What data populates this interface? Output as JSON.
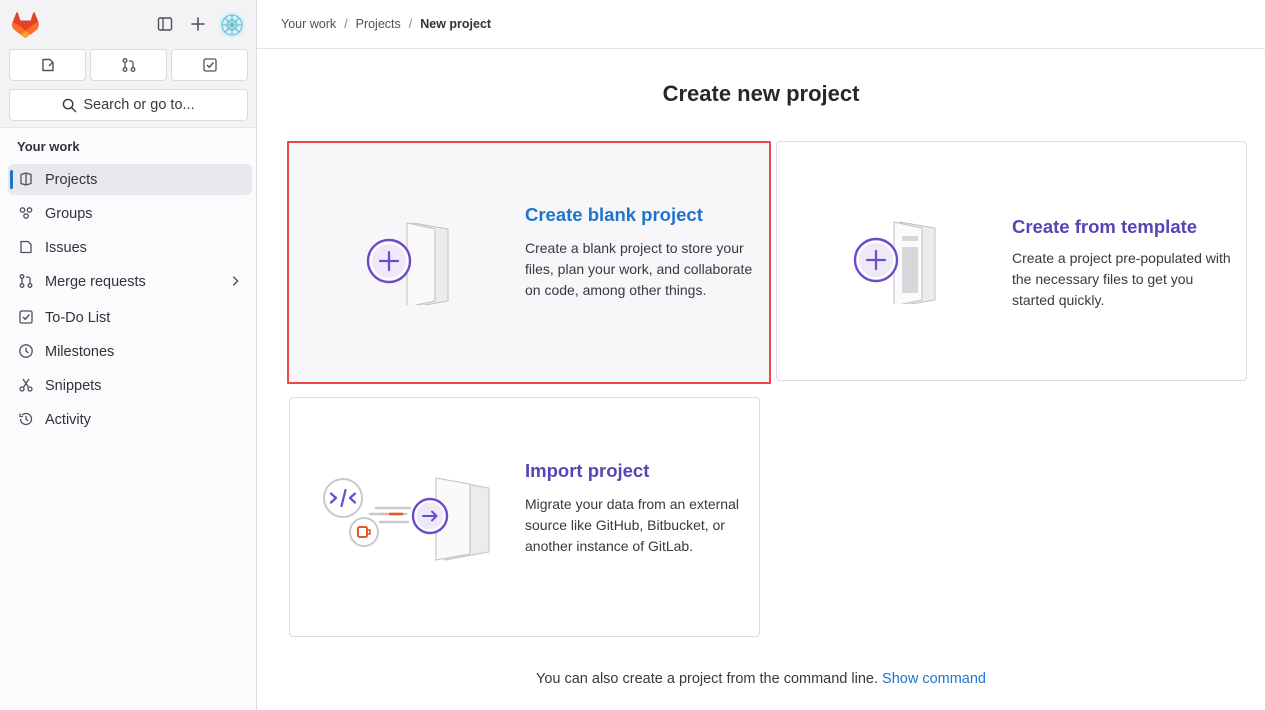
{
  "sidebar": {
    "search_label": "Search or go to...",
    "section_title": "Your work",
    "items": [
      {
        "label": "Projects",
        "icon": "project-icon"
      },
      {
        "label": "Groups",
        "icon": "group-icon"
      },
      {
        "label": "Issues",
        "icon": "issues-icon"
      },
      {
        "label": "Merge requests",
        "icon": "merge-request-icon"
      },
      {
        "label": "To-Do List",
        "icon": "todo-icon"
      },
      {
        "label": "Milestones",
        "icon": "clock-icon"
      },
      {
        "label": "Snippets",
        "icon": "snippet-icon"
      },
      {
        "label": "Activity",
        "icon": "history-icon"
      }
    ]
  },
  "breadcrumb": {
    "items": [
      "Your work",
      "Projects",
      "New project"
    ],
    "separator": "/"
  },
  "main": {
    "title": "Create new project",
    "cards": [
      {
        "title": "Create blank project",
        "description": "Create a blank project to store your files, plan your work, and collaborate on code, among other things."
      },
      {
        "title": "Create from template",
        "description": "Create a project pre-populated with the necessary files to get you started quickly."
      },
      {
        "title": "Import project",
        "description": "Migrate your data from an external source like GitHub, Bitbucket, or another instance of GitLab."
      }
    ],
    "footer_text": "You can also create a project from the command line.",
    "footer_link": "Show command"
  },
  "colors": {
    "accent_blue": "#1f75cb",
    "purple": "#5943b6",
    "selection_border": "#e84848",
    "logo_orange": "#e24329"
  }
}
